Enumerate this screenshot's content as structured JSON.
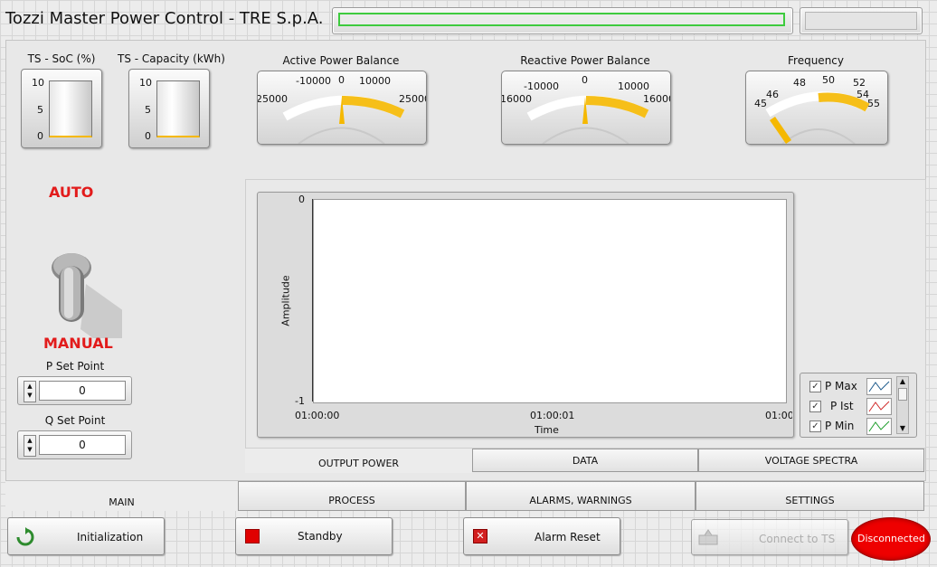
{
  "window": {
    "title": "Tozzi Master Power Control - TRE S.p.A."
  },
  "indicators": {
    "ts_soc": {
      "label": "TS - SoC (%)",
      "ticks": [
        "10",
        "5",
        "0"
      ]
    },
    "ts_capacity": {
      "label": "TS - Capacity (kWh)",
      "ticks": [
        "10",
        "5",
        "0"
      ]
    }
  },
  "gauges": {
    "active": {
      "label": "Active Power Balance",
      "ticks": [
        "25000",
        "-10000",
        "0",
        "10000",
        "25000"
      ]
    },
    "reactive": {
      "label": "Reactive Power Balance",
      "ticks": [
        "16000",
        "-10000",
        "0",
        "10000",
        "16000"
      ]
    },
    "frequency": {
      "label": "Frequency",
      "ticks": [
        "45",
        "46",
        "48",
        "50",
        "52",
        "54",
        "55"
      ]
    }
  },
  "mode": {
    "auto_label": "AUTO",
    "manual_label": "MANUAL"
  },
  "setpoints": {
    "p": {
      "label": "P Set Point",
      "value": "0"
    },
    "q": {
      "label": "Q Set Point",
      "value": "0"
    }
  },
  "chart": {
    "y_label": "Amplitude",
    "x_label": "Time",
    "y_ticks": [
      "0",
      "-1"
    ],
    "x_ticks": [
      "01:00:00",
      "01:00:01",
      "01:00:0"
    ]
  },
  "legend": {
    "items": [
      {
        "label": "P Max",
        "checked": "✓",
        "color": "#1d5a8c"
      },
      {
        "label": "P Ist",
        "checked": "✓",
        "color": "#d12b2b"
      },
      {
        "label": "P Min",
        "checked": "✓",
        "color": "#1f9e2c"
      }
    ]
  },
  "inner_tabs": [
    "OUTPUT POWER",
    "DATA",
    "VOLTAGE SPECTRA"
  ],
  "main_tabs": [
    "MAIN",
    "PROCESS",
    "ALARMS, WARNINGS",
    "SETTINGS"
  ],
  "buttons": {
    "initialization": "Initialization",
    "standby": "Standby",
    "alarm_reset": "Alarm Reset",
    "connect": "Connect to TS",
    "status": "Disconnected"
  },
  "colors": {
    "accent": "#f5b800",
    "alert": "#e21b1b",
    "status_bg": "#ee0000"
  }
}
